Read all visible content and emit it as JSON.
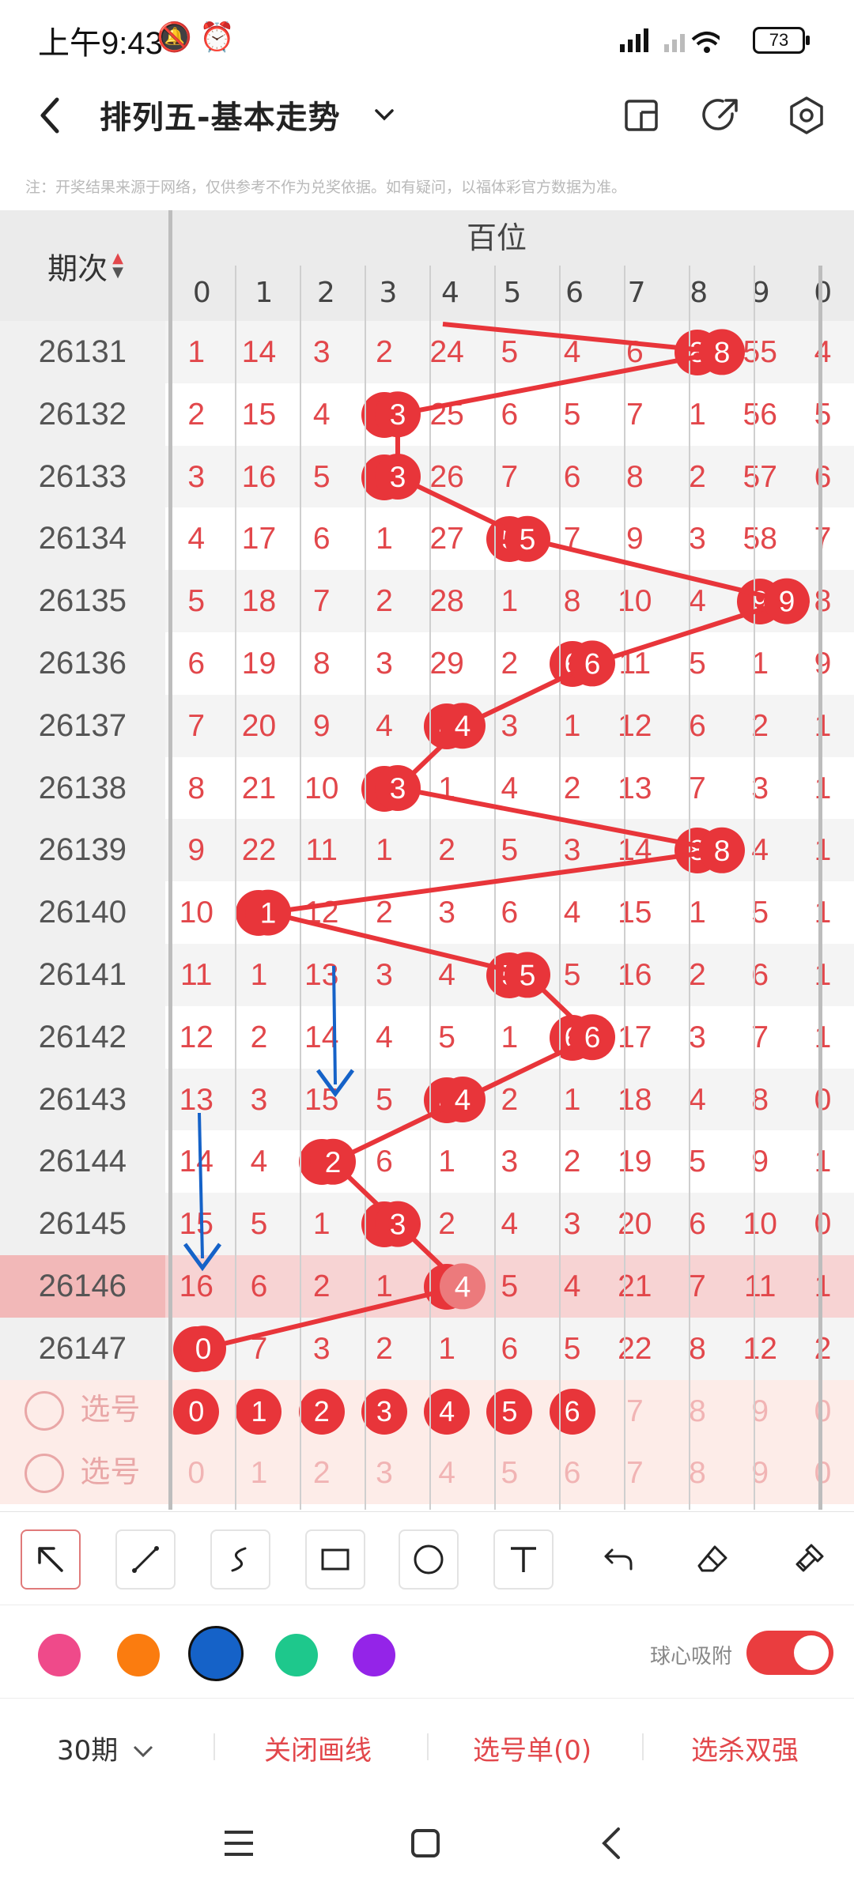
{
  "status_bar": {
    "time": "上午9:43",
    "battery": "73"
  },
  "header": {
    "title": "排列五-基本走势"
  },
  "notice": "注：开奖结果来源于网络，仅供参考不作为兑奖依据。如有疑问，以福体彩官方数据为准。",
  "table": {
    "period_header": "期次",
    "position_header": "百位",
    "digit_headers": [
      "0",
      "1",
      "2",
      "3",
      "4",
      "5",
      "6",
      "7",
      "8",
      "9",
      "0"
    ],
    "rows": [
      {
        "period": "26131",
        "cells": [
          "1",
          "14",
          "3",
          "2",
          "24",
          "5",
          "4",
          "6",
          "8",
          "55",
          "4"
        ],
        "ball": 8
      },
      {
        "period": "26132",
        "cells": [
          "2",
          "15",
          "4",
          "3",
          "25",
          "6",
          "5",
          "7",
          "1",
          "56",
          "5"
        ],
        "ball": 3
      },
      {
        "period": "26133",
        "cells": [
          "3",
          "16",
          "5",
          "3",
          "26",
          "7",
          "6",
          "8",
          "2",
          "57",
          "6"
        ],
        "ball": 3
      },
      {
        "period": "26134",
        "cells": [
          "4",
          "17",
          "6",
          "1",
          "27",
          "5",
          "7",
          "9",
          "3",
          "58",
          "7"
        ],
        "ball": 5
      },
      {
        "period": "26135",
        "cells": [
          "5",
          "18",
          "7",
          "2",
          "28",
          "1",
          "8",
          "10",
          "4",
          "9",
          "8"
        ],
        "ball": 9
      },
      {
        "period": "26136",
        "cells": [
          "6",
          "19",
          "8",
          "3",
          "29",
          "2",
          "6",
          "11",
          "5",
          "1",
          "9"
        ],
        "ball": 6
      },
      {
        "period": "26137",
        "cells": [
          "7",
          "20",
          "9",
          "4",
          "4",
          "3",
          "1",
          "12",
          "6",
          "2",
          "1"
        ],
        "ball": 4
      },
      {
        "period": "26138",
        "cells": [
          "8",
          "21",
          "10",
          "3",
          "1",
          "4",
          "2",
          "13",
          "7",
          "3",
          "1"
        ],
        "ball": 3
      },
      {
        "period": "26139",
        "cells": [
          "9",
          "22",
          "11",
          "1",
          "2",
          "5",
          "3",
          "14",
          "8",
          "4",
          "1"
        ],
        "ball": 8
      },
      {
        "period": "26140",
        "cells": [
          "10",
          "1",
          "12",
          "2",
          "3",
          "6",
          "4",
          "15",
          "1",
          "5",
          "1"
        ],
        "ball": 1
      },
      {
        "period": "26141",
        "cells": [
          "11",
          "1",
          "13",
          "3",
          "4",
          "5",
          "5",
          "16",
          "2",
          "6",
          "1"
        ],
        "ball": 5
      },
      {
        "period": "26142",
        "cells": [
          "12",
          "2",
          "14",
          "4",
          "5",
          "1",
          "6",
          "17",
          "3",
          "7",
          "1"
        ],
        "ball": 6
      },
      {
        "period": "26143",
        "cells": [
          "13",
          "3",
          "15",
          "5",
          "4",
          "2",
          "1",
          "18",
          "4",
          "8",
          "0"
        ],
        "ball": 4
      },
      {
        "period": "26144",
        "cells": [
          "14",
          "4",
          "2",
          "6",
          "1",
          "3",
          "2",
          "19",
          "5",
          "9",
          "1"
        ],
        "ball": 2
      },
      {
        "period": "26145",
        "cells": [
          "15",
          "5",
          "1",
          "3",
          "2",
          "4",
          "3",
          "20",
          "6",
          "10",
          "0"
        ],
        "ball": 3
      },
      {
        "period": "26146",
        "cells": [
          "16",
          "6",
          "2",
          "1",
          "4",
          "5",
          "4",
          "21",
          "7",
          "11",
          "1"
        ],
        "ball": 4
      },
      {
        "period": "26147",
        "cells": [
          "0",
          "7",
          "3",
          "2",
          "1",
          "6",
          "5",
          "22",
          "8",
          "12",
          "2"
        ],
        "ball": 0
      }
    ],
    "pick_label": "选号",
    "pick_rows": [
      {
        "cells": [
          "0",
          "1",
          "2",
          "3",
          "4",
          "5",
          "6",
          "7",
          "8",
          "9",
          "0"
        ],
        "selected": [
          0,
          1,
          2,
          3,
          4,
          5,
          6
        ]
      },
      {
        "cells": [
          "0",
          "1",
          "2",
          "3",
          "4",
          "5",
          "6",
          "7",
          "8",
          "9",
          "0"
        ],
        "selected": []
      }
    ]
  },
  "draw_colors": [
    "#ef4a8a",
    "#fb7c0f",
    "#1562c8",
    "#1ec88c",
    "#9424e8"
  ],
  "selected_color": "#1562c8",
  "snap_label": "球心吸附",
  "snap_enabled": true,
  "bottom_bar": {
    "periods": "30期",
    "close_lines": "关闭画线",
    "pick_list": "选号单(0)",
    "kill": "选杀双强"
  },
  "icons": {
    "tools": [
      "arrow-tool-icon",
      "line-tool-icon",
      "freehand-tool-icon",
      "rectangle-tool-icon",
      "circle-tool-icon",
      "text-tool-icon",
      "undo-icon",
      "eraser-icon",
      "clear-brush-icon"
    ],
    "header": [
      "back-icon",
      "chevron-down-icon",
      "layout-icon",
      "share-icon",
      "settings-icon"
    ]
  }
}
